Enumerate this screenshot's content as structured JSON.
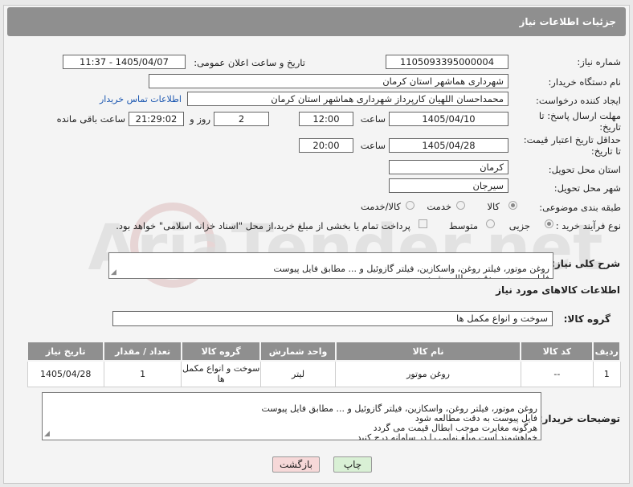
{
  "page": {
    "header_title": "جزئیات اطلاعات نیاز"
  },
  "fields": {
    "need_number_label": "شماره نیاز:",
    "need_number": "1105093395000004",
    "announce_label": "تاریخ و ساعت اعلان عمومی:",
    "announce_value": "1405/04/07 - 11:37",
    "buyer_org_label": "نام دستگاه خریدار:",
    "buyer_org": "شهرداری هماشهر استان کرمان",
    "creator_label": "ایجاد کننده درخواست:",
    "creator": "محمداحسان اللهیان کارپرداز  شهرداری هماشهر استان کرمان",
    "contact_link": "اطلاعات تماس خریدار",
    "deadline_label_1": "مهلت ارسال پاسخ: تا",
    "deadline_label_2": "تاریخ:",
    "deadline_date": "1405/04/10",
    "time_label": "ساعت",
    "deadline_time": "12:00",
    "days_value": "2",
    "days_label": "روز و",
    "remaining_time": "21:29:02",
    "remaining_label": "ساعت باقی مانده",
    "validity_label_1": "حداقل تاریخ اعتبار قیمت:",
    "validity_label_2": "تا تاریخ:",
    "validity_date": "1405/04/28",
    "validity_time_label": "ساعت",
    "validity_time": "20:00",
    "province_label": "استان محل تحویل:",
    "province": "کرمان",
    "city_label": "شهر محل تحویل:",
    "city": "سیرجان",
    "category_label": "طبقه بندی موضوعی:",
    "category_options": [
      "کالا",
      "خدمت",
      "کالا/خدمت"
    ],
    "process_label": "نوع فرآیند خرید :",
    "process_options": [
      "جزیی",
      "متوسط"
    ],
    "treasury_note": "پرداخت تمام یا بخشی از مبلغ خرید،از محل \"اسناد خزانه اسلامی\" خواهد بود.",
    "description_label": "شرح کلی نیاز:",
    "description": "روغن موتور، فیلتر روغن، واسکازین، فیلتر گازوئیل و ... مطابق فایل پیوست\nفایل پیوست به دقت مطالعه شود",
    "goods_info_title": "اطلاعات کالاهای مورد نیاز",
    "goods_group_label": "گروه کالا:",
    "goods_group": "سوخت و انواع مکمل ها",
    "buyer_notes_label": "توضیحات خریدار:",
    "buyer_notes": "روغن موتور، فیلتر روغن، واسکازین، فیلتر گازوئیل و ... مطابق فایل پیوست\nفایل پیوست به دقت مطالعه شود\nهرگونه مغایرت موجب ابطال قیمت می گردد\nخواهشمند است مبلغ نهایی را در سامانه درج کنید"
  },
  "table": {
    "headers": [
      "ردیف",
      "کد کالا",
      "نام کالا",
      "واحد شمارش",
      "گروه کالا",
      "تعداد / مقدار",
      "تاریخ نیاز"
    ],
    "rows": [
      {
        "row": "1",
        "code": "--",
        "name": "روغن موتور",
        "unit": "لیتر",
        "group": "سوخت و انواع مکمل ها",
        "qty": "1",
        "date": "1405/04/28"
      }
    ]
  },
  "buttons": {
    "print": "چاپ",
    "back": "بازگشت"
  },
  "watermark": "AriaTender.net",
  "colors": {
    "header_bg": "#8f8f8f",
    "link": "#1a56b0",
    "print_btn": "#d9f0d5",
    "back_btn": "#f6d8d8"
  }
}
